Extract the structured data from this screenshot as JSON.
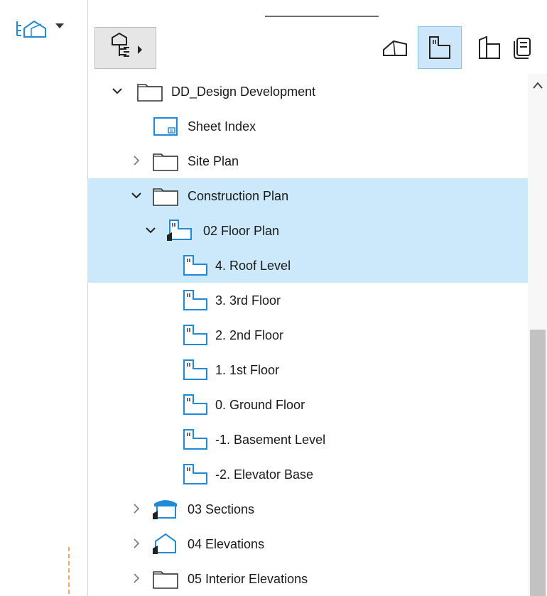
{
  "toolbar": {
    "navigator_switch_icon": "project-map-icon",
    "options_icon": "tree-options-icon",
    "view_buttons": [
      {
        "icon": "project-map-icon",
        "active": false
      },
      {
        "icon": "view-map-icon",
        "active": true
      },
      {
        "icon": "layout-book-icon",
        "active": false
      },
      {
        "icon": "publisher-sets-icon",
        "active": false
      }
    ]
  },
  "tree": {
    "items": [
      {
        "label": "DD_Design Development",
        "indent": 0,
        "icon": "folder-icon",
        "expander": "expanded",
        "selected": false
      },
      {
        "label": "Sheet Index",
        "indent": 1,
        "icon": "sheet-index-icon",
        "expander": "none",
        "selected": false
      },
      {
        "label": "Site Plan",
        "indent": 1,
        "icon": "folder-icon",
        "expander": "collapsed",
        "selected": false
      },
      {
        "label": "Construction Plan",
        "indent": 1,
        "icon": "folder-icon",
        "expander": "expanded",
        "selected": true
      },
      {
        "label": "02 Floor Plan",
        "indent": 2,
        "icon": "floor-plan-folder-icon",
        "expander": "expanded",
        "selected": true
      },
      {
        "label": "4. Roof Level",
        "indent": 3,
        "icon": "floor-plan-icon",
        "expander": "none",
        "selected": true
      },
      {
        "label": "3. 3rd Floor",
        "indent": 3,
        "icon": "floor-plan-icon",
        "expander": "none",
        "selected": false
      },
      {
        "label": "2. 2nd Floor",
        "indent": 3,
        "icon": "floor-plan-icon",
        "expander": "none",
        "selected": false
      },
      {
        "label": "1. 1st Floor",
        "indent": 3,
        "icon": "floor-plan-icon",
        "expander": "none",
        "selected": false
      },
      {
        "label": "0. Ground Floor",
        "indent": 3,
        "icon": "floor-plan-icon",
        "expander": "none",
        "selected": false
      },
      {
        "label": "-1. Basement Level",
        "indent": 3,
        "icon": "floor-plan-icon",
        "expander": "none",
        "selected": false
      },
      {
        "label": "-2. Elevator Base",
        "indent": 3,
        "icon": "floor-plan-icon",
        "expander": "none",
        "selected": false
      },
      {
        "label": "03 Sections",
        "indent": 1,
        "icon": "section-folder-icon",
        "expander": "collapsed",
        "selected": false
      },
      {
        "label": "04 Elevations",
        "indent": 1,
        "icon": "elevation-folder-icon",
        "expander": "collapsed",
        "selected": false
      },
      {
        "label": "05 Interior Elevations",
        "indent": 1,
        "icon": "folder-icon",
        "expander": "collapsed",
        "selected": false
      }
    ]
  },
  "colors": {
    "selection": "#cce8fb",
    "active_button": "#cde6f9",
    "icon_blue": "#1f8bd8",
    "scrollbar_thumb": "#c2c2c2"
  }
}
